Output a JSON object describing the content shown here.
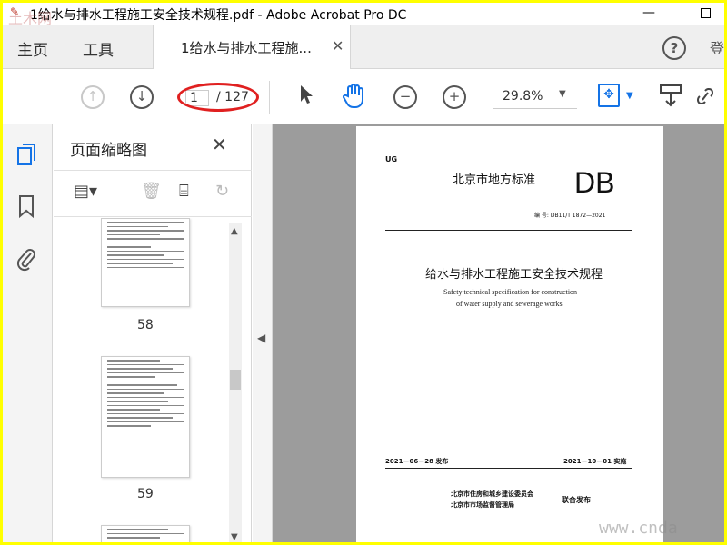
{
  "window": {
    "title": "1给水与排水工程施工安全技术规程.pdf - Adobe Acrobat Pro DC",
    "minimize": "—"
  },
  "tabs": {
    "home": "主页",
    "tools": "工具",
    "document": "1给水与排水工程施...",
    "close": "✕",
    "help": "?"
  },
  "toolbar": {
    "page_current": "1",
    "page_total": "/ 127",
    "zoom": "29.8%",
    "zoom_dropdown": "▼",
    "prev_page_icon": "arrow-up-icon",
    "next_page_icon": "arrow-down-icon"
  },
  "panel": {
    "title": "页面缩略图",
    "close": "✕",
    "thumbnails": [
      {
        "page": "58"
      },
      {
        "page": "59"
      }
    ]
  },
  "document": {
    "ug": "UG",
    "standard_type": "北京市地方标准",
    "db": "DB",
    "code": "编    号: DB11/T 1872—2021",
    "cn_title": "给水与排水工程施工安全技术规程",
    "en_title_line1": "Safety technical specification for construction",
    "en_title_line2": "of water supply and sewerage works",
    "publish_date": "2021－06－28 发布",
    "implement_date": "2021－10－01 实施",
    "issuer1": "北京市住房和城乡建设委员会",
    "issuer2": "北京市市场监督管理局",
    "joint_release": "联合发布"
  },
  "watermarks": {
    "top_left": "土木网",
    "bottom_right": "www.cnda"
  },
  "colors": {
    "accent": "#1473e6",
    "highlight_oval": "#e02020",
    "border": "#ffff00"
  }
}
